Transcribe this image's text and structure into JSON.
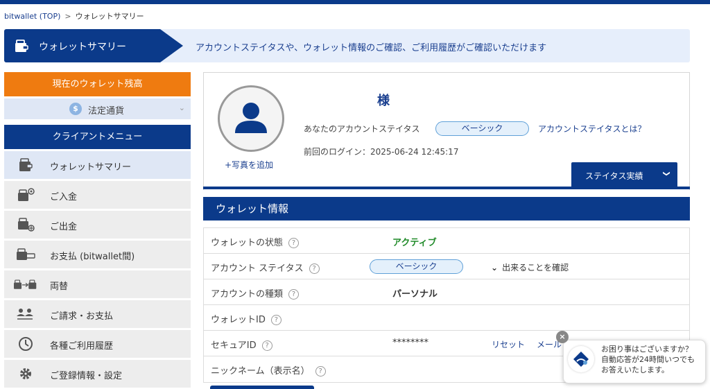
{
  "breadcrumb": {
    "home": "bitwallet (TOP)",
    "separator": ">",
    "current": "ウォレットサマリー"
  },
  "banner": {
    "title": "ウォレットサマリー",
    "description": "アカウントステイタスや、ウォレット情報のご確認、ご利用履歴がご確認いただけます"
  },
  "sidebar": {
    "balance_label": "現在のウォレット残高",
    "currency": {
      "symbol": "$",
      "label": "法定通貨",
      "chevron": "⌄"
    },
    "menu_header": "クライアントメニュー",
    "items": [
      {
        "label": "ウォレットサマリー",
        "icon": "wallet-icon"
      },
      {
        "label": "ご入金",
        "icon": "deposit-icon"
      },
      {
        "label": "ご出金",
        "icon": "withdraw-icon"
      },
      {
        "label": "お支払 (bitwallet間)",
        "icon": "payment-icon"
      },
      {
        "label": "両替",
        "icon": "exchange-icon"
      },
      {
        "label": "ご請求・お支払",
        "icon": "users-icon"
      },
      {
        "label": "各種ご利用履歴",
        "icon": "history-icon"
      },
      {
        "label": "ご登録情報・設定",
        "icon": "gear-icon"
      }
    ]
  },
  "profile": {
    "add_photo": "+写真を追加",
    "honorific": "様",
    "status_label": "あなたのアカウントステイタス",
    "status_value": "ベーシック",
    "status_what": "アカウントステイタスとは？",
    "last_login": "前回のログイン：2025-06-24 12:45:17",
    "status_button": "ステイタス実績",
    "status_button_chevron": "❯"
  },
  "wallet_info": {
    "header": "ウォレット情報",
    "help_glyph": "?",
    "rows": {
      "state": {
        "label": "ウォレットの状態",
        "value": "アクティブ"
      },
      "status": {
        "label": "アカウント ステイタス",
        "value": "ベーシック",
        "confirm": "出来ることを確認",
        "confirm_chevron": "⌄"
      },
      "type": {
        "label": "アカウントの種類",
        "value": "パーソナル"
      },
      "id": {
        "label": "ウォレットID",
        "value": ""
      },
      "secure": {
        "label": "セキュアID",
        "value": "********",
        "reset": "リセット",
        "mail": "メール"
      },
      "nickname": {
        "label": "ニックネーム（表示名）",
        "value": ""
      }
    }
  },
  "chat": {
    "lines": [
      "お困り事はございますか？",
      "自動応答が24時間いつでも",
      "お答えいたします。"
    ],
    "close": "×"
  },
  "colors": {
    "primary": "#0b3a8a",
    "accent": "#ef7b10",
    "active": "#1f8a28",
    "banner_bg": "#e6eefb"
  }
}
